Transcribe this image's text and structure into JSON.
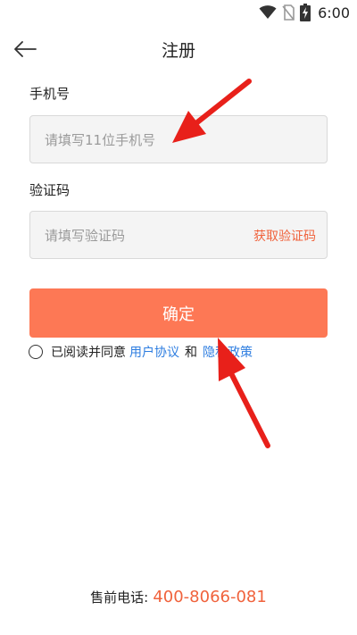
{
  "status_bar": {
    "time": "6:00",
    "icons": [
      "wifi-icon",
      "no-sim-icon",
      "battery-charging-icon"
    ]
  },
  "header": {
    "back_icon": "arrow-left-icon",
    "title": "注册"
  },
  "form": {
    "phone_label": "手机号",
    "phone_placeholder": "请填写11位手机号",
    "phone_value": "",
    "code_label": "验证码",
    "code_placeholder": "请填写验证码",
    "code_value": "",
    "get_code_label": "获取验证码",
    "confirm_label": "确定"
  },
  "agreement": {
    "checked": false,
    "prefix": "已阅读并同意",
    "user_agreement": "用户协议",
    "and": "和",
    "privacy_policy": "隐私政策"
  },
  "footer": {
    "phone_label": "售前电话:",
    "phone_number": "400-8066-081"
  },
  "colors": {
    "accent": "#fd7855",
    "link": "#2d7de0",
    "highlight_text": "#f0623c",
    "annotation_arrow": "#e8201a"
  }
}
